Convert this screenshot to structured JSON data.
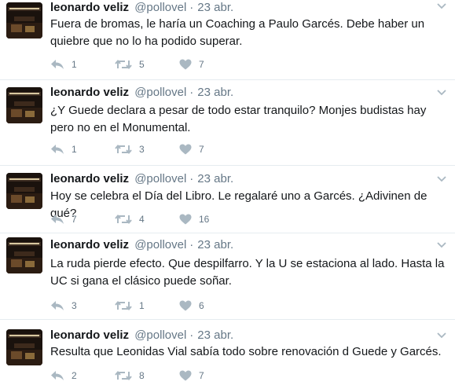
{
  "colors": {
    "icon": "#aab8c2",
    "muted": "#657786",
    "text": "#14171a",
    "border": "#e6ecf0"
  },
  "icons": {
    "reply": "reply-icon",
    "retweet": "retweet-icon",
    "like": "heart-icon",
    "more": "chevron-down-icon"
  },
  "tweets": [
    {
      "name": "leonardo veliz",
      "handle": "@pollovel",
      "separator": "·",
      "date": "23 abr.",
      "text": "Fuera de bromas, le haría un Coaching a Paulo Garcés. Debe haber un quiebre que no lo ha podido superar.",
      "replies": "1",
      "retweets": "5",
      "likes": "7"
    },
    {
      "name": "leonardo veliz",
      "handle": "@pollovel",
      "separator": "·",
      "date": "23 abr.",
      "text": "¿Y Guede declara a pesar de todo estar tranquilo? Monjes budistas hay pero no en el Monumental.",
      "replies": "1",
      "retweets": "3",
      "likes": "7"
    },
    {
      "name": "leonardo veliz",
      "handle": "@pollovel",
      "separator": "·",
      "date": "23 abr.",
      "text": "Hoy se celebra el Día del Libro. Le regalaré uno a Garcés. ¿Adivinen de qué?",
      "replies": "7",
      "retweets": "4",
      "likes": "16"
    },
    {
      "name": "leonardo veliz",
      "handle": "@pollovel",
      "separator": "·",
      "date": "23 abr.",
      "text": "La ruda pierde efecto. Que despilfarro. Y la U se estaciona al lado. Hasta la UC si gana el clásico puede soñar.",
      "replies": "3",
      "retweets": "1",
      "likes": "6"
    },
    {
      "name": "leonardo veliz",
      "handle": "@pollovel",
      "separator": "·",
      "date": "23 abr.",
      "text": "Resulta que Leonidas Vial sabía todo sobre renovación d Guede y Garcés.",
      "replies": "2",
      "retweets": "8",
      "likes": "7"
    }
  ]
}
